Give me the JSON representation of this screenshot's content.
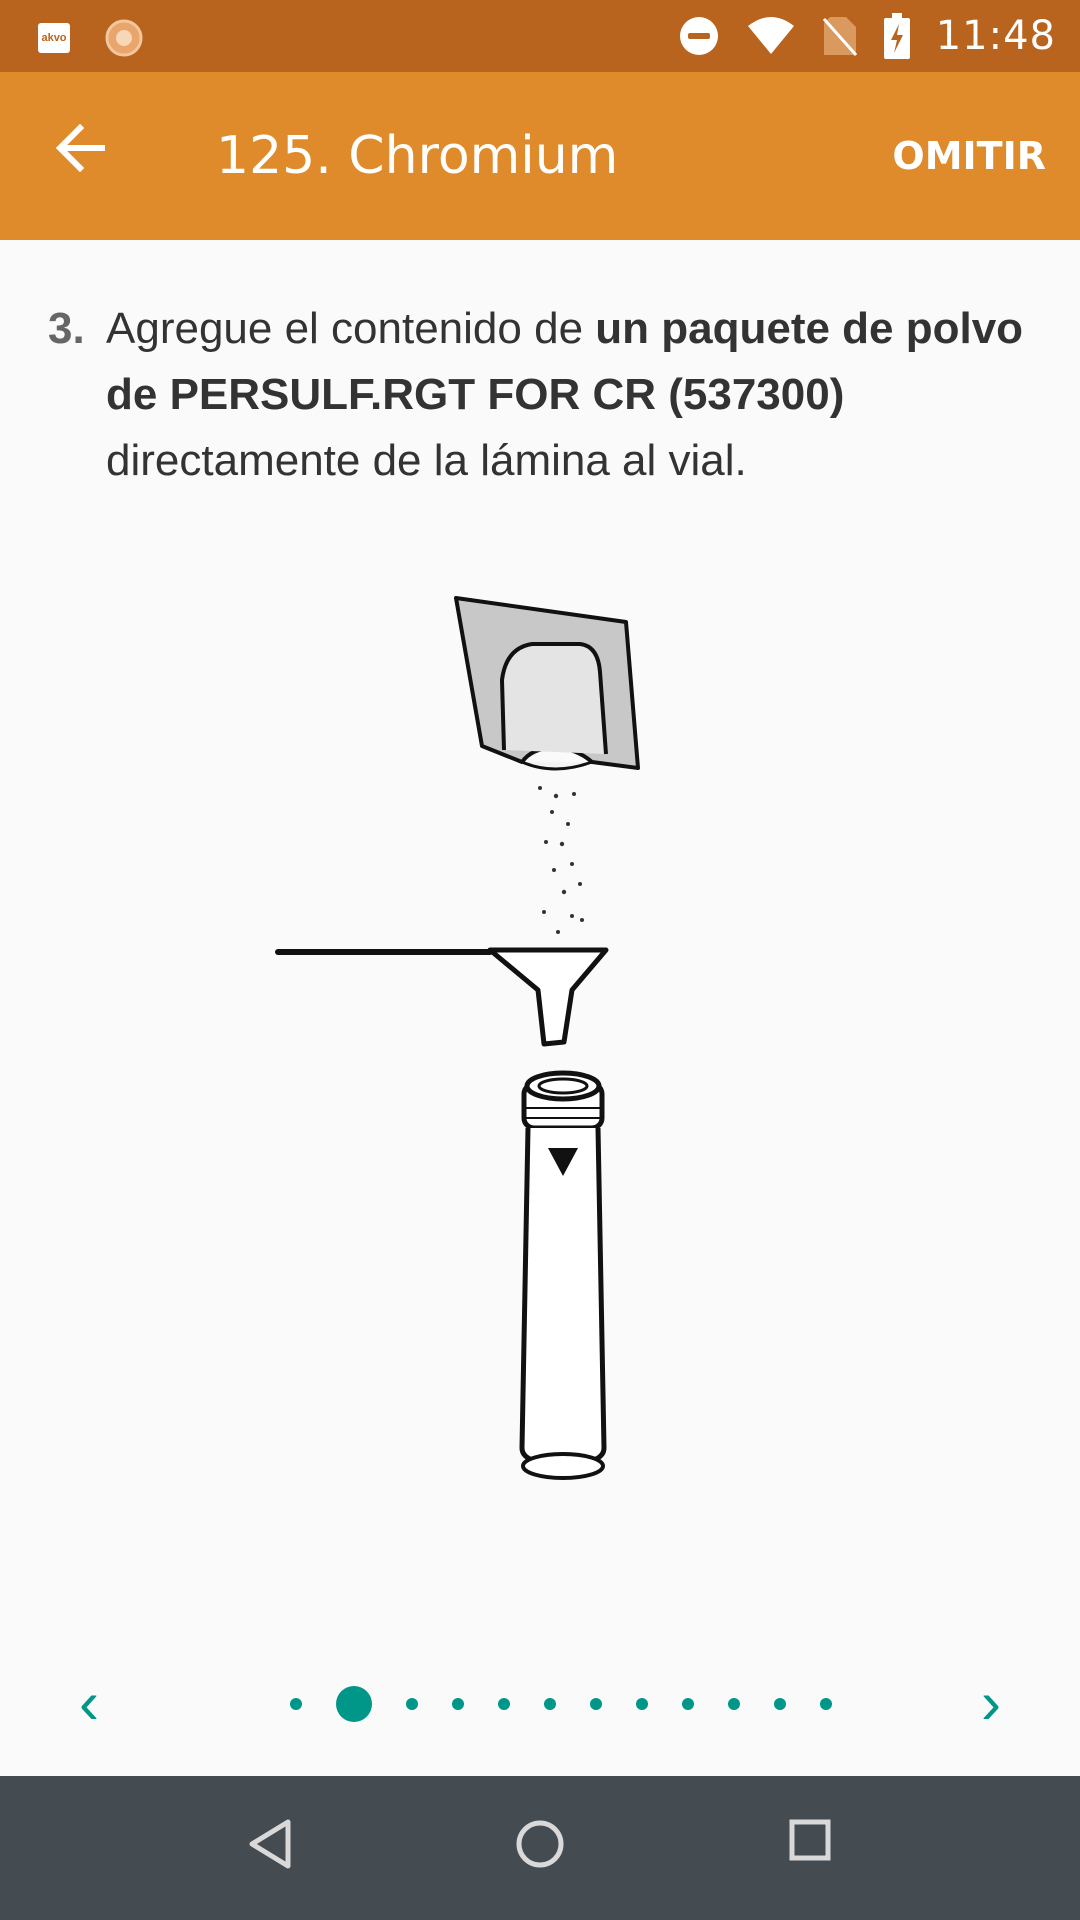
{
  "status_bar": {
    "time": "11:48",
    "app_icon_label": "akvo",
    "icons": [
      "akvo-icon",
      "loader-icon",
      "do-not-disturb-icon",
      "wifi-icon",
      "no-sim-icon",
      "battery-charging-icon"
    ]
  },
  "app_bar": {
    "title": "125. Chromium",
    "skip_label": "OMITIR",
    "back_icon": "arrow-left-icon"
  },
  "step": {
    "number": "3.",
    "text_before": "Agregue el contenido de ",
    "text_bold": "un paquete de polvo de PERSULF.RGT FOR CR (537300)",
    "text_after": " directamente de la lámina al vial."
  },
  "pager": {
    "prev_icon": "chevron-left-icon",
    "next_icon": "chevron-right-icon",
    "prev_glyph": "‹",
    "next_glyph": "›",
    "total_pages": 12,
    "current_page": 2
  },
  "nav_bar": {
    "icons": [
      "back-triangle-icon",
      "home-circle-icon",
      "recents-square-icon"
    ]
  },
  "colors": {
    "status_bar": "#b9641e",
    "app_bar": "#df8a2b",
    "accent": "#009688",
    "nav_bar": "#444b51"
  }
}
